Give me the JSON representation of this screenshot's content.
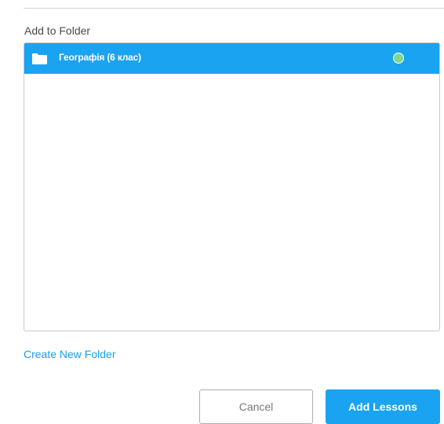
{
  "dialog": {
    "section_label": "Add to Folder",
    "folders": [
      {
        "name": "Географія (6 клас)",
        "selected": true,
        "icon": "folder-icon"
      }
    ],
    "create_folder_link": "Create New Folder",
    "cancel_label": "Cancel",
    "submit_label": "Add Lessons"
  },
  "colors": {
    "accent": "#1aa3f0",
    "link": "#1b9ee8",
    "selected_indicator": "#7fd88e",
    "label_text": "#4a4a4a",
    "border": "#c9c9c9"
  }
}
